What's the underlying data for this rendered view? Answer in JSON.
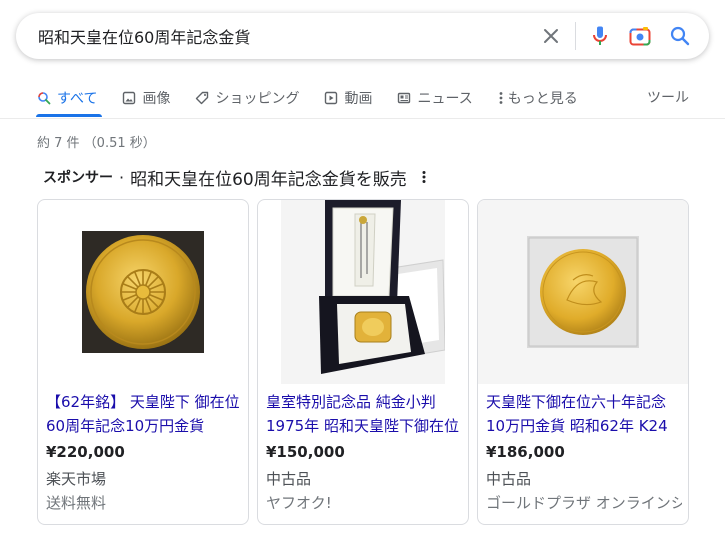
{
  "search": {
    "query": "昭和天皇在位60周年記念金貨",
    "clear_icon": "close-icon",
    "voice_icon": "mic-icon",
    "lens_icon": "camera-icon",
    "search_icon": "search-icon"
  },
  "tabs": [
    {
      "label": "すべて",
      "icon": "search-icon",
      "active": true
    },
    {
      "label": "画像",
      "icon": "image-icon"
    },
    {
      "label": "ショッピング",
      "icon": "tag-icon"
    },
    {
      "label": "動画",
      "icon": "play-icon"
    },
    {
      "label": "ニュース",
      "icon": "news-icon"
    },
    {
      "label": "もっと見る",
      "icon": "more-vert-icon"
    }
  ],
  "tools_label": "ツール",
  "result_stats": "約 7 件 （0.51 秒）",
  "sponsored": {
    "label": "スポンサー",
    "separator": "·",
    "title": "昭和天皇在位60周年記念金貨を販売"
  },
  "products": [
    {
      "title": "【62年銘】 天皇陛下 御在位60周年記念10万円金貨",
      "price": "¥220,000",
      "merchant": "楽天市場",
      "shipping": "送料無料",
      "image": "gold-coin-photo"
    },
    {
      "title": "皇室特別記念品 純金小判 1975年 昭和天皇陛下御在位",
      "price": "¥150,000",
      "merchant": "中古品",
      "shipping": "ヤフオク!",
      "image": "gold-bar-in-case-photo"
    },
    {
      "title": "天皇陛下御在位六十年記念 10万円金貨 昭和62年 K24",
      "price": "¥186,000",
      "merchant": "中古品",
      "shipping": "ゴールドプラザ オンラインショップ",
      "image": "gold-coin-in-holder-photo"
    }
  ],
  "colors": {
    "accent": "#1a73e8",
    "link": "#1a0dab",
    "gold": "#d4a017"
  }
}
